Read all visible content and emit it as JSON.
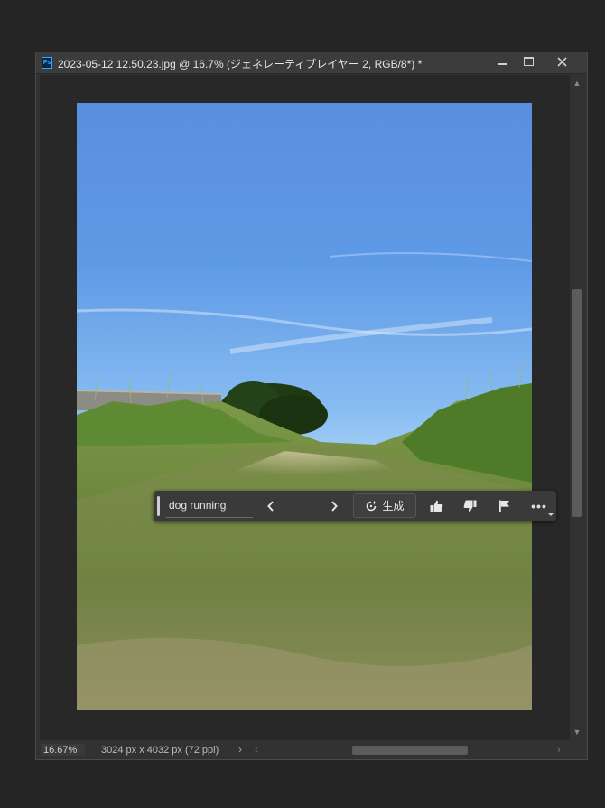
{
  "window": {
    "title": "2023-05-12 12.50.23.jpg @ 16.7% (ジェネレーティブレイヤー 2, RGB/8*) *",
    "app_icon_text": "Ps"
  },
  "status": {
    "zoom": "16.67%",
    "doc_info": "3024 px x 4032 px (72 ppi)"
  },
  "generative_bar": {
    "prompt": "dog running",
    "generate_label": "生成",
    "more_label": "•••"
  },
  "icons": {
    "prev": "chevron-left-icon",
    "next": "chevron-right-icon",
    "generate": "generative-sparkle-icon",
    "like": "thumbs-up-icon",
    "dislike": "thumbs-down-icon",
    "flag": "flag-icon",
    "more": "more-horizontal-icon"
  },
  "colors": {
    "app_bg": "#252525",
    "panel": "#323232",
    "accent_ps": "#31a8ff"
  }
}
